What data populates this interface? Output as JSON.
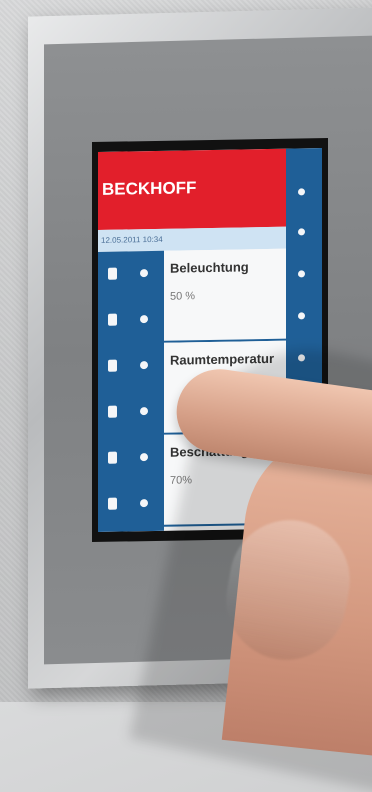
{
  "device": {
    "logo_text": "BECKHOFF",
    "subheader_text": "12.05.2011 10:34",
    "items": [
      {
        "title": "Beleuchtung",
        "value": "50 %"
      },
      {
        "title": "Raumtemperatur",
        "value": ""
      },
      {
        "title": "Beschattung",
        "value": "70%"
      }
    ]
  }
}
